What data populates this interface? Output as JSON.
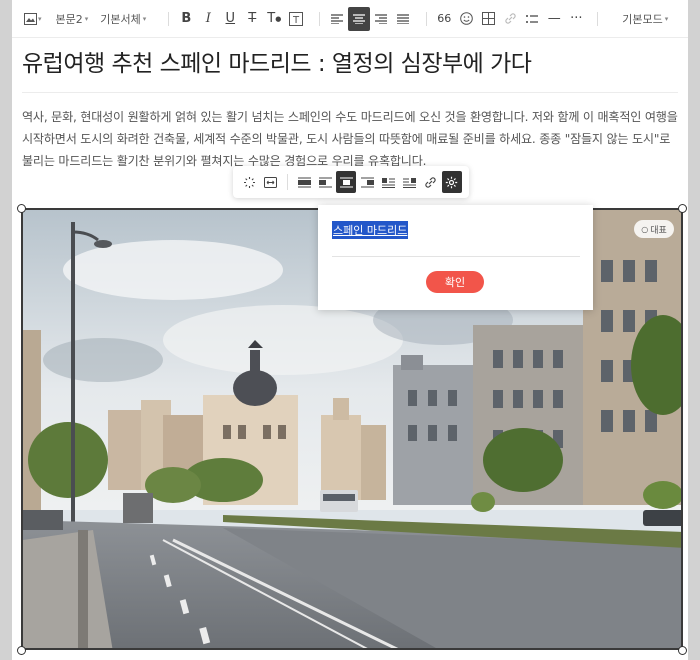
{
  "toolbar": {
    "paragraph_label": "본문2",
    "font_label": "기본서체",
    "mode_label": "기본모드",
    "emoji_label": "66"
  },
  "document": {
    "title": "유럽여행 추천 스페인 마드리드 : 열정의 심장부에 가다",
    "paragraph": "역사, 문화, 현대성이 원활하게 얽혀 있는 활기 넘치는 스페인의 수도 마드리드에 오신 것을 환영합니다. 저와 함께 이 매혹적인 여행을 시작하면서 도시의 화려한 건축물, 세계적 수준의 박물관, 도시 사람들의 따뜻함에 매료될 준비를 하세요. 종종 \"잠들지 않는 도시\"로 불리는 마드리드는 활기찬 분위기와 펼쳐지는 수많은 경험으로 우리를 유혹합니다."
  },
  "caption_popover": {
    "value": "스페인 마드리드",
    "confirm_label": "확인"
  },
  "image": {
    "badge": "대표"
  },
  "colors": {
    "accent": "#f2554a",
    "selection": "#2357c9"
  }
}
